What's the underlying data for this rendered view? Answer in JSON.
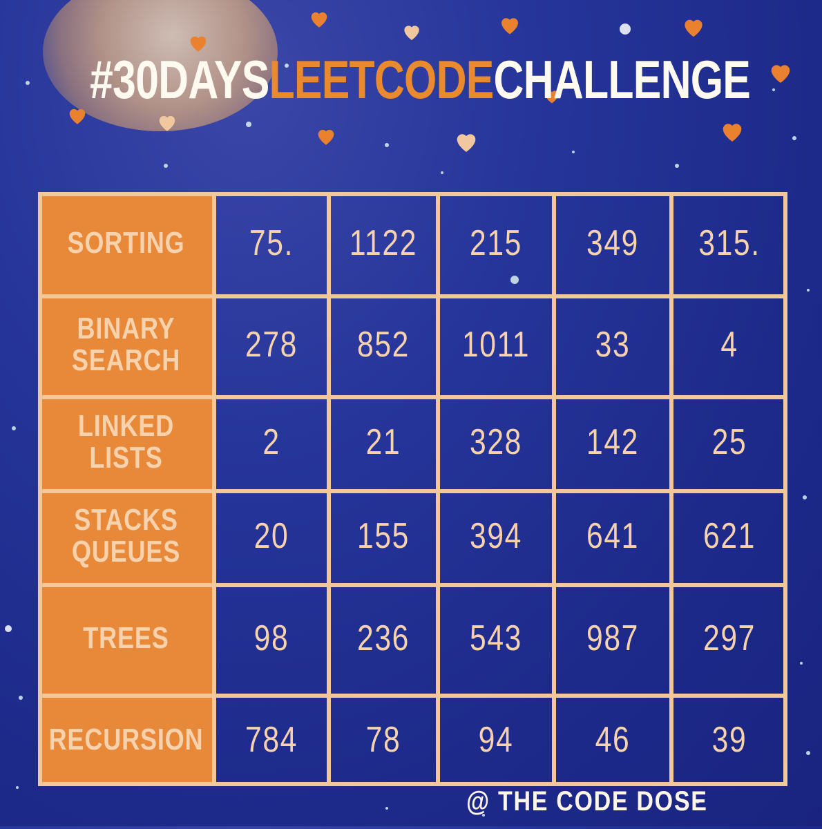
{
  "title": {
    "part1": "#30DAYS",
    "part2": "LEETCODE",
    "part3": "CHALLENGE"
  },
  "table": {
    "rows": [
      {
        "topic": "SORTING",
        "problems": [
          "75.",
          "1122",
          "215",
          "349",
          "315."
        ]
      },
      {
        "topic": "BINARY\nSEARCH",
        "problems": [
          "278",
          "852",
          "1011",
          "33",
          "4"
        ]
      },
      {
        "topic": "LINKED\nLISTS",
        "problems": [
          "2",
          "21",
          "328",
          "142",
          "25"
        ]
      },
      {
        "topic": "STACKS\nQUEUES",
        "problems": [
          "20",
          "155",
          "394",
          "641",
          "621"
        ]
      },
      {
        "topic": "TREES",
        "problems": [
          "98",
          "236",
          "543",
          "987",
          "297"
        ]
      },
      {
        "topic": "RECURSION",
        "problems": [
          "784",
          "78",
          "94",
          "46",
          "39"
        ]
      }
    ]
  },
  "footer": {
    "credit": "@ THE CODE DOSE"
  },
  "colors": {
    "background": "#1f2b8c",
    "accent_orange": "#e98a2e",
    "line_peach": "#f2c79a",
    "header_fill": "#e8893a"
  },
  "decorations": {
    "icons": [
      "moon",
      "heart-icon",
      "star-dots"
    ]
  }
}
